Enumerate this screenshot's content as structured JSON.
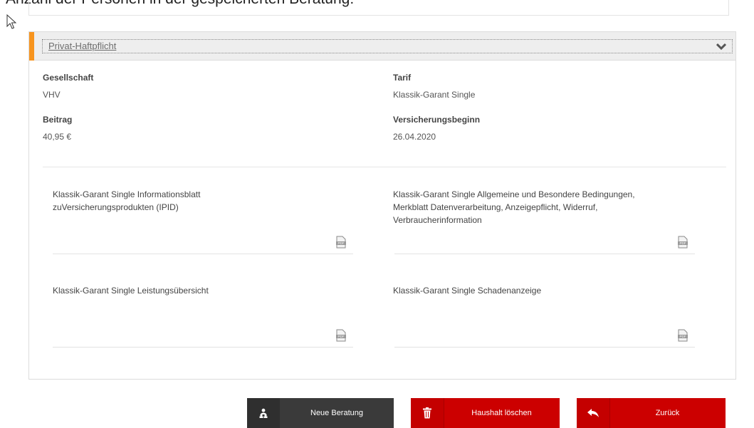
{
  "page": {
    "caption": "Anzahl der Personen in der gespeicherten Beratung:"
  },
  "accordion": {
    "title": "Privat-Haftpflicht",
    "icons": {
      "toggle": "chevron-down-icon"
    }
  },
  "details": {
    "company_label": "Gesellschaft",
    "company_value": "VHV",
    "tariff_label": "Tarif",
    "tariff_value": "Klassik-Garant Single",
    "premium_label": "Beitrag",
    "premium_value": "40,95 €",
    "start_label": "Versicherungsbeginn",
    "start_value": "26.04.2020"
  },
  "documents": [
    {
      "line1": "Klassik-Garant Single Informationsblatt",
      "line2": "zuVersicherungsprodukten (IPID)",
      "line3": "",
      "icon": "pdf-icon"
    },
    {
      "line1": "Klassik-Garant Single Allgemeine und Besondere Bedingungen,",
      "line2": "Merkblatt Datenverarbeitung, Anzeigepflicht, Widerruf,",
      "line3": "Verbraucherinformation",
      "icon": "pdf-icon"
    },
    {
      "line1": "Klassik-Garant Single Leistungsübersicht",
      "line2": "",
      "line3": "",
      "icon": "pdf-icon"
    },
    {
      "line1": "Klassik-Garant Single Schadenanzeige",
      "line2": "",
      "line3": "",
      "icon": "pdf-icon"
    }
  ],
  "buttons": {
    "new_consultation": {
      "label": "Neue Beratung",
      "icon": "users-icon"
    },
    "delete_household": {
      "label": "Haushalt löschen",
      "icon": "trash-icon"
    },
    "back": {
      "label": "Zurück",
      "icon": "back-arrow-icon"
    }
  },
  "colors": {
    "accent_orange": "#f7941e",
    "button_red": "#cc0000",
    "button_dark": "#3a3a3a"
  }
}
